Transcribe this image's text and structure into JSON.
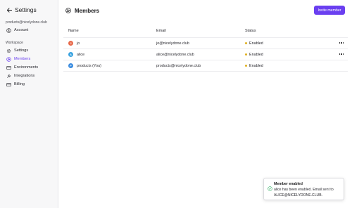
{
  "sidebar": {
    "title": "Settings",
    "account_email": "products@nicelydone.club",
    "account_label": "Account",
    "section_label": "Workspace",
    "items": [
      {
        "label": "Settings",
        "icon": "gear-icon"
      },
      {
        "label": "Members",
        "icon": "members-icon"
      },
      {
        "label": "Environments",
        "icon": "environments-icon"
      },
      {
        "label": "Integrations",
        "icon": "integrations-icon"
      },
      {
        "label": "Billing",
        "icon": "billing-icon"
      }
    ],
    "active_item": "Members"
  },
  "header": {
    "title": "Members",
    "invite_label": "Invite member"
  },
  "table": {
    "columns": [
      "Name",
      "Email",
      "Status"
    ],
    "rows": [
      {
        "initial": "J",
        "name": "jo",
        "email": "jo@nicelydone.club",
        "status": "Enabled",
        "avatar_color": "#e8694a"
      },
      {
        "initial": "A",
        "name": "alice",
        "email": "alice@nicelydone.club",
        "status": "Enabled",
        "avatar_color": "#3aa3e0"
      },
      {
        "initial": "P",
        "name": "products (You)",
        "email": "products@nicelydone.club",
        "status": "Enabled",
        "avatar_color": "#3a8ce0"
      }
    ]
  },
  "toast": {
    "title": "Member enabled",
    "message": "alice has been enabled. Email sent to ALICE@NICELYDONE.CLUB."
  },
  "colors": {
    "accent": "#6a3ff0",
    "status_enabled": "#e0b020",
    "toast_success": "#3bb36b"
  }
}
